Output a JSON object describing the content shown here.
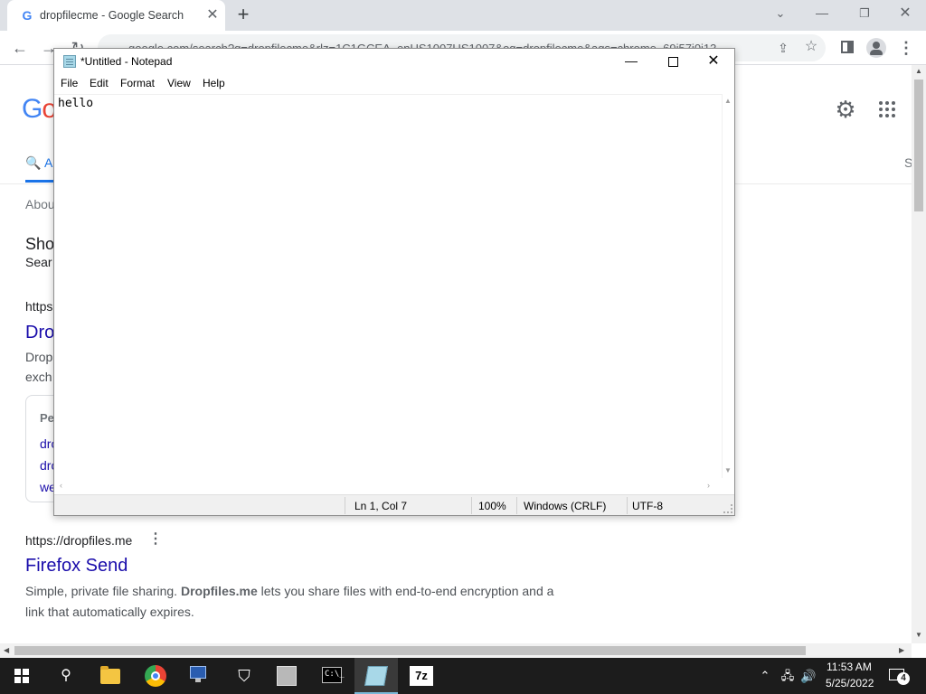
{
  "browser": {
    "tab": {
      "title": "dropfilecme - Google Search",
      "favicon": "G",
      "close": "✕"
    },
    "new_tab": "+",
    "tab_search": "⌄",
    "window_controls": {
      "minimize": "—",
      "restore": "❐",
      "close": "✕"
    },
    "nav": {
      "back": "←",
      "forward": "→",
      "reload": "↻"
    },
    "url": "google.com/search?q=dropfilecme&rlz=1C1GCEA_enUS1007US1007&oq=dropfilecme&aqs=chrome..69i57j0i13...",
    "share": "⇪",
    "star": "☆",
    "menu": "⋮"
  },
  "google": {
    "logo_g": "G",
    "logo_o": "o",
    "settings_icon": "⚙",
    "tab_all_icon": "🔍",
    "tab_all_label": "A",
    "tab_right_label": "S",
    "about": "Abou",
    "show_heading": "Sho",
    "show_sub": "Sear",
    "result1_url": "https",
    "result1_title": "Dro",
    "result1_snippet1": "Drop",
    "result1_snippet2": "exch",
    "people_also": "Pe",
    "pa_items": [
      "dro",
      "dro",
      "we"
    ],
    "result2_url": "https://dropfiles.me",
    "result2_more": "⋮",
    "result2_title": "Firefox Send",
    "result2_snippet1_a": "Simple, private file sharing. ",
    "result2_snippet1_b": "Dropfiles.me",
    "result2_snippet1_c": " lets you share files with end-to-end encryption and a",
    "result2_snippet2": "link that automatically expires."
  },
  "notepad": {
    "title": "*Untitled - Notepad",
    "controls": {
      "minimize": "—",
      "close": "✕"
    },
    "menus": [
      "File",
      "Edit",
      "Format",
      "View",
      "Help"
    ],
    "content": "hello",
    "status": {
      "position": "Ln 1, Col 7",
      "zoom": "100%",
      "line_ending": "Windows (CRLF)",
      "encoding": "UTF-8"
    }
  },
  "taskbar": {
    "search_icon": "⚲",
    "shield_icon": "⛉",
    "cmd_icon": "C:\\_",
    "seven_zip": "7z",
    "tray_chevron": "⌃",
    "tray_network": "🖧",
    "tray_volume": "🔊",
    "time": "11:53 AM",
    "date": "5/25/2022",
    "notification_count": "4"
  }
}
